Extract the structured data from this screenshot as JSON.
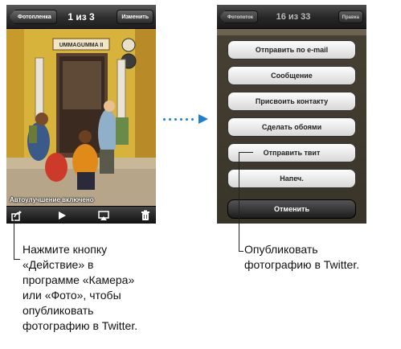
{
  "left_screen": {
    "back_label": "Фотопленка",
    "title": "1 из 3",
    "edit_label": "Изменить",
    "photo_caption": "Автоулучшение включено",
    "toolbar_icons": [
      "share-icon",
      "play-icon",
      "airplay-icon",
      "trash-icon"
    ]
  },
  "right_screen": {
    "back_label": "Фотопоток",
    "title": "16 из 33",
    "edit_label": "Правка",
    "actions": [
      "Отправить по e-mail",
      "Сообщение",
      "Присвоить контакту",
      "Сделать обоями",
      "Отправить твит",
      "Напеч."
    ],
    "cancel_label": "Отменить"
  },
  "callouts": {
    "left_lines": [
      "Нажмите кнопку",
      "«Действие» в",
      "программе «Камера»",
      "или «Фото», чтобы",
      "опубликовать",
      "фотографию в Twitter."
    ],
    "right_lines": [
      "Опубликовать",
      "фотографию в Twitter."
    ]
  },
  "colors": {
    "arrow": "#1c7fd6"
  }
}
